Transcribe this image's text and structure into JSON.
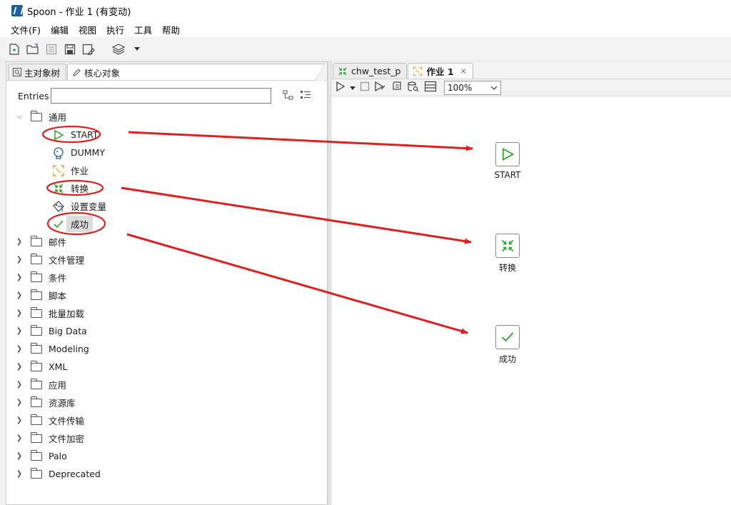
{
  "window": {
    "title": "Spoon - 作业 1 (有变动)"
  },
  "menu": [
    "文件(F)",
    "编辑",
    "视图",
    "执行",
    "工具",
    "帮助"
  ],
  "left_panel": {
    "tabs": [
      {
        "label": "主对象树",
        "icon": "search-icon"
      },
      {
        "label": "核心对象",
        "icon": "pencil-icon"
      }
    ],
    "entries_label": "Entries",
    "entries_value": "",
    "tree": {
      "open_folder": "通用",
      "leaves": [
        {
          "label": "START",
          "icon": "start-icon"
        },
        {
          "label": "DUMMY",
          "icon": "dummy-icon"
        },
        {
          "label": "作业",
          "icon": "job-icon"
        },
        {
          "label": "转换",
          "icon": "transform-icon"
        },
        {
          "label": "设置变量",
          "icon": "set-variable-icon"
        },
        {
          "label": "成功",
          "icon": "success-icon"
        }
      ],
      "folders": [
        "邮件",
        "文件管理",
        "条件",
        "脚本",
        "批量加载",
        "Big Data",
        "Modeling",
        "XML",
        "应用",
        "资源库",
        "文件传输",
        "文件加密",
        "Palo",
        "Deprecated"
      ]
    }
  },
  "right_panel": {
    "tabs": [
      {
        "label": "chw_test_p",
        "icon": "transformation-tab-icon"
      },
      {
        "label": "作业 1",
        "icon": "job-tab-icon",
        "closable": true
      }
    ],
    "zoom": "100%",
    "nodes": [
      {
        "label": "START",
        "icon": "start-icon"
      },
      {
        "label": "转换",
        "icon": "transform-icon"
      },
      {
        "label": "成功",
        "icon": "success-icon"
      }
    ]
  },
  "colors": {
    "annotation": "#e02020",
    "start_green": "#2aa52a",
    "job_orange": "#f0a030"
  }
}
